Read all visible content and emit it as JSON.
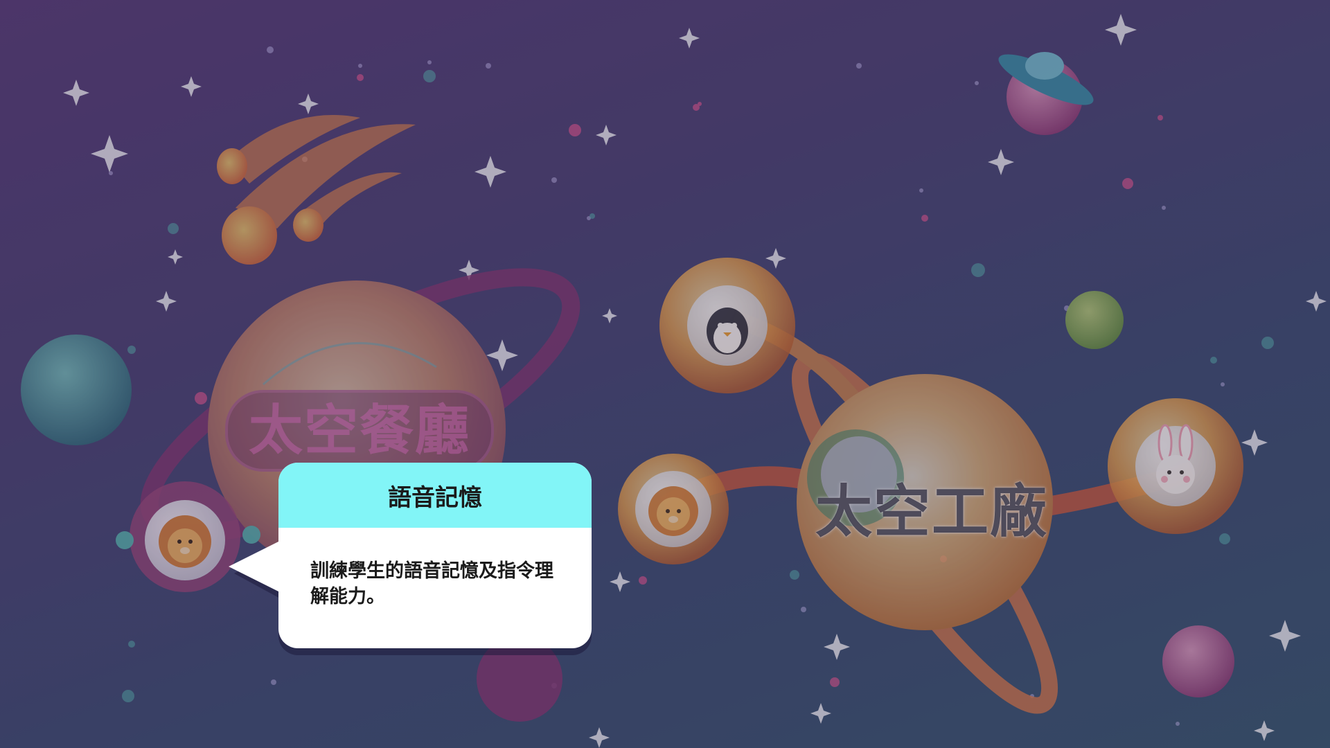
{
  "planets": {
    "restaurant": {
      "title": "太空餐廳"
    },
    "factory": {
      "title": "太空工廠"
    }
  },
  "game_nodes": {
    "restaurant_lion": {
      "character": "lion-icon"
    },
    "factory_penguin": {
      "character": "penguin-icon"
    },
    "factory_lion": {
      "character": "lion-icon"
    },
    "factory_rabbit": {
      "character": "rabbit-icon"
    }
  },
  "tooltip": {
    "title": "語音記憶",
    "description": "訓練學生的語音記憶及指令理解能力。"
  },
  "colors": {
    "tooltip_header": "#82f5f7",
    "tooltip_body": "#ffffff",
    "background_top": "#5a3f78",
    "background_bottom": "#3a5a70"
  }
}
